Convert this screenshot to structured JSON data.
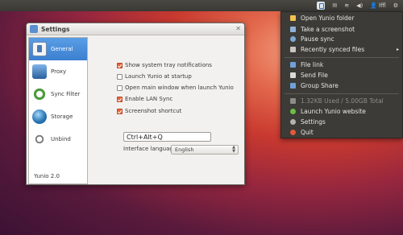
{
  "panel": {
    "indicators": [
      {
        "icon": "yunio-tray-icon"
      },
      {
        "icon": "mail-icon",
        "glyph": "✉"
      },
      {
        "icon": "network-icon",
        "glyph": "≋"
      },
      {
        "icon": "volume-icon",
        "glyph": "◀)"
      },
      {
        "icon": "user-icon",
        "glyph": "👤",
        "label": "lffl"
      },
      {
        "icon": "power-gear-icon",
        "glyph": "⚙"
      }
    ],
    "username": "lffl"
  },
  "settings_window": {
    "title": "Settings",
    "close_glyph": "✕",
    "nav": [
      {
        "label": "General",
        "active": true,
        "icon": "general-icon"
      },
      {
        "label": "Proxy",
        "active": false,
        "icon": "proxy-icon"
      },
      {
        "label": "Sync Filter",
        "active": false,
        "icon": "sync-filter-icon"
      },
      {
        "label": "Storage",
        "active": false,
        "icon": "storage-icon"
      },
      {
        "label": "Unbind",
        "active": false,
        "icon": "unbind-icon"
      }
    ],
    "version": "Yunio 2.0",
    "options": [
      {
        "label": "Show system tray notifications",
        "checked": true
      },
      {
        "label": "Launch Yunio at startup",
        "checked": false
      },
      {
        "label": "Open main window when launch Yunio",
        "checked": false
      },
      {
        "label": "Enable LAN Sync",
        "checked": true
      },
      {
        "label": "Screenshot shortcut",
        "checked": true
      }
    ],
    "shortcut_value": "Ctrl+Alt+Q",
    "language_label": "Interface language:",
    "language_value": "English"
  },
  "tray_menu": {
    "items": [
      {
        "label": "Open Yunio folder",
        "icon": "folder-icon",
        "color": "#f2c14e"
      },
      {
        "label": "Take a screenshot",
        "icon": "screenshot-icon",
        "color": "#8fb3d9"
      },
      {
        "label": "Pause sync",
        "icon": "pause-icon",
        "color": "#7ea8d6"
      },
      {
        "label": "Recently synced files",
        "icon": "recent-files-icon",
        "color": "#c9c6bf",
        "submenu": "▸"
      },
      {
        "label": "File link",
        "icon": "file-link-icon",
        "color": "#6fa0d8"
      },
      {
        "label": "Send File",
        "icon": "send-file-icon",
        "color": "#dcdad4"
      },
      {
        "label": "Group Share",
        "icon": "group-share-icon",
        "color": "#6fa0d8"
      },
      {
        "label": "1.32KB Used / 5.00GB Total",
        "icon": "storage-usage-icon",
        "color": "#8e8c86",
        "disabled": true
      },
      {
        "label": "Launch Yunio website",
        "icon": "website-icon",
        "color": "#6dbd45"
      },
      {
        "label": "Settings",
        "icon": "settings-icon",
        "color": "#b5b3ad"
      },
      {
        "label": "Quit",
        "icon": "quit-icon",
        "color": "#e05a3a"
      }
    ]
  }
}
